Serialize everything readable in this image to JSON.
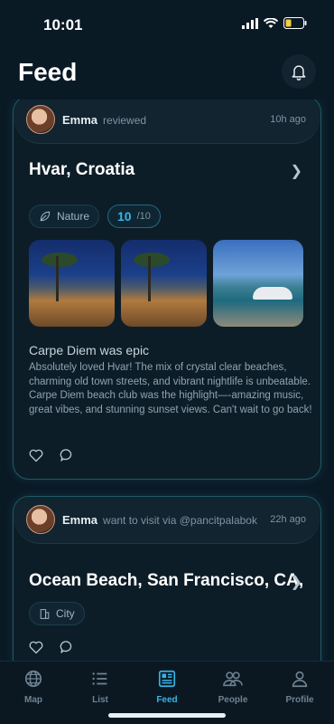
{
  "status": {
    "time": "10:01"
  },
  "header": {
    "title": "Feed",
    "bell_icon": "bell-icon"
  },
  "feed": {
    "posts": [
      {
        "user": "Emma",
        "action": "reviewed",
        "ago": "10h ago",
        "place": "Hvar, Croatia",
        "tag": "Nature",
        "score": "10",
        "score_max": "/10",
        "review_title": "Carpe Diem was epic",
        "review_body": "Absolutely loved Hvar! The mix of crystal clear beaches, charming old town streets, and vibrant nightlife is unbeatable. Carpe Diem beach club was the highlight—-amazing music, great vibes, and stunning sunset views. Can't wait to go back!"
      },
      {
        "user": "Emma",
        "action": "want to visit via @pancitpalabok",
        "ago": "22h ago",
        "place": "Ocean Beach, San Francisco, CA,",
        "tag": "City"
      }
    ]
  },
  "tabs": [
    {
      "label": "Map",
      "icon": "globe-icon"
    },
    {
      "label": "List",
      "icon": "list-icon"
    },
    {
      "label": "Feed",
      "icon": "newspaper-icon",
      "active": true
    },
    {
      "label": "People",
      "icon": "people-icon"
    },
    {
      "label": "Profile",
      "icon": "person-icon"
    }
  ],
  "colors": {
    "accent": "#37b4e8",
    "background": "#0a1a25",
    "card_border": "#1f5a66"
  }
}
